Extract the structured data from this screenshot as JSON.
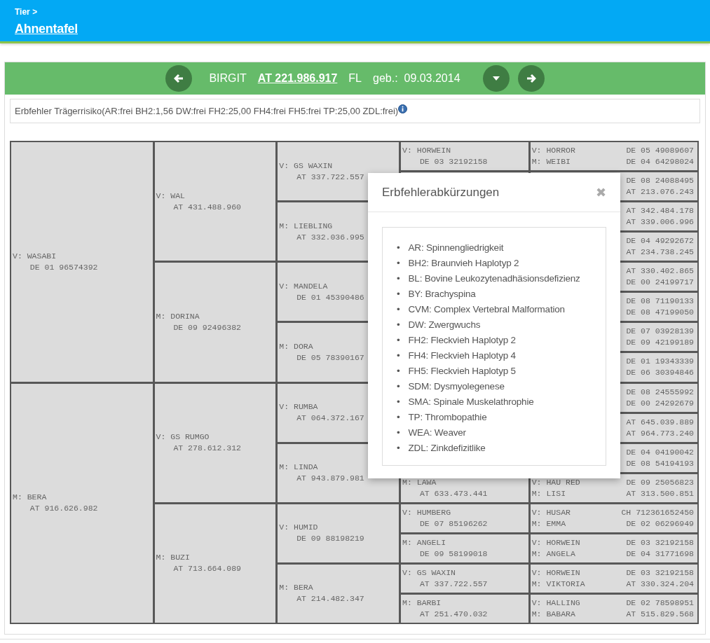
{
  "header": {
    "breadcrumb": "Tier >",
    "title": "Ahnentafel"
  },
  "animal": {
    "name": "BIRGIT",
    "id": "AT 221.986.917",
    "breed": "FL",
    "born_label": "geb.:",
    "born": "09.03.2014"
  },
  "risk": {
    "text": "Erbfehler Trägerrisiko(AR:frei BH2:1,56 DW:frei FH2:25,00 FH4:frei FH5:frei TP:25,00 ZDL:frei)"
  },
  "pedigree": {
    "generations": [
      [
        {
          "sex": "V:",
          "name": "WASABI",
          "id": "DE 01 96574392"
        },
        {
          "sex": "M:",
          "name": "BERA",
          "id": "AT 916.626.982"
        }
      ],
      [
        {
          "sex": "V:",
          "name": "WAL",
          "id": "AT 431.488.960"
        },
        {
          "sex": "M:",
          "name": "DORINA",
          "id": "DE 09 92496382"
        },
        {
          "sex": "V:",
          "name": "GS RUMGO",
          "id": "AT 278.612.312"
        },
        {
          "sex": "M:",
          "name": "BUZI",
          "id": "AT 713.664.089"
        }
      ],
      [
        {
          "sex": "V:",
          "name": "GS WAXIN",
          "id": "AT 337.722.557"
        },
        {
          "sex": "M:",
          "name": "LIEBLING",
          "id": "AT 332.036.995"
        },
        {
          "sex": "V:",
          "name": "MANDELA",
          "id": "DE 01 45390486"
        },
        {
          "sex": "M:",
          "name": "DORA",
          "id": "DE 05 78390167"
        },
        {
          "sex": "V:",
          "name": "RUMBA",
          "id": "AT 064.372.167"
        },
        {
          "sex": "M:",
          "name": "LINDA",
          "id": "AT 943.879.981"
        },
        {
          "sex": "V:",
          "name": "HUMID",
          "id": "DE 09 88198219"
        },
        {
          "sex": "M:",
          "name": "BERA",
          "id": "AT 214.482.347"
        }
      ],
      {
        "top": [
          {
            "sex": "V:",
            "name": "HORWEIN",
            "id": "DE 03 32192158"
          }
        ],
        "bottom": [
          {
            "sex": "M:",
            "name": "LAWA",
            "id": "AT 633.473.441"
          },
          {
            "sex": "V:",
            "name": "HUMBERG",
            "id": "DE 07 85196262"
          },
          {
            "sex": "M:",
            "name": "ANGELI",
            "id": "DE 09 58199018"
          },
          {
            "sex": "V:",
            "name": "GS WAXIN",
            "id": "AT 337.722.557"
          },
          {
            "sex": "M:",
            "name": "BARBI",
            "id": "AT 251.470.032"
          }
        ]
      },
      [
        {
          "sire": {
            "sex": "V:",
            "name": "HORROR",
            "id": "DE 05 49089607"
          },
          "dam": {
            "sex": "M:",
            "name": "WEIBI",
            "id": "DE 04 64298024"
          }
        },
        {
          "sire": {
            "id": "DE 08 24088495"
          },
          "dam": {
            "id": "AT 213.076.243"
          }
        },
        {
          "sire": {
            "id": "AT 342.484.178"
          },
          "dam": {
            "id": "AT 339.006.996"
          }
        },
        {
          "sire": {
            "id": "DE 04 49292672"
          },
          "dam": {
            "id": "AT 234.738.245"
          }
        },
        {
          "sire": {
            "id": "AT 330.402.865"
          },
          "dam": {
            "id": "DE 00 24199717"
          }
        },
        {
          "sire": {
            "id": "DE 08 71190133"
          },
          "dam": {
            "id": "DE 08 47199050"
          }
        },
        {
          "sire": {
            "id": "DE 07 03928139"
          },
          "dam": {
            "id": "DE 09 42199189"
          }
        },
        {
          "sire": {
            "id": "DE 01 19343339"
          },
          "dam": {
            "id": "DE 06 30394846"
          }
        },
        {
          "sire": {
            "id": "DE 08 24555992"
          },
          "dam": {
            "id": "DE 00 24292679"
          }
        },
        {
          "sire": {
            "id": "AT 645.039.889"
          },
          "dam": {
            "id": "AT 964.773.240"
          }
        },
        {
          "sire": {
            "id": "DE 04 04190042"
          },
          "dam": {
            "id": "DE 08 54194193"
          }
        },
        {
          "sire": {
            "sex": "V:",
            "name": "HAU RED",
            "id": "DE 09 25056823"
          },
          "dam": {
            "sex": "M:",
            "name": "LISI",
            "id": "AT 313.500.851"
          }
        },
        {
          "sire": {
            "sex": "V:",
            "name": "HUSAR",
            "id": "CH 712361652450"
          },
          "dam": {
            "sex": "M:",
            "name": "EMMA",
            "id": "DE 02 06296949"
          }
        },
        {
          "sire": {
            "sex": "V:",
            "name": "HORWEIN",
            "id": "DE 03 32192158"
          },
          "dam": {
            "sex": "M:",
            "name": "ANGELA",
            "id": "DE 04 31771698"
          }
        },
        {
          "sire": {
            "sex": "V:",
            "name": "HORWEIN",
            "id": "DE 03 32192158"
          },
          "dam": {
            "sex": "M:",
            "name": "VIKTORIA",
            "id": "AT 330.324.204"
          }
        },
        {
          "sire": {
            "sex": "V:",
            "name": "HALLING",
            "id": "DE 02 78598951"
          },
          "dam": {
            "sex": "M:",
            "name": "BABARA",
            "id": "AT 515.829.568"
          }
        }
      ]
    ]
  },
  "modal": {
    "title": "Erbfehlerabkürzungen",
    "close": "✖",
    "marker": "•",
    "items": [
      "AR: Spinnengliedrigkeit",
      "BH2: Braunvieh Haplotyp 2",
      "BL: Bovine Leukozytenadhäsionsdefizienz",
      "BY: Brachyspina",
      "CVM: Complex Vertebral Malformation",
      "DW: Zwergwuchs",
      "FH2: Fleckvieh Haplotyp 2",
      "FH4: Fleckvieh Haplotyp 4",
      "FH5: Fleckvieh Haplotyp 5",
      "SDM: Dysmyolegenese",
      "SMA: Spinale Muskelathrophie",
      "TP: Thrombopathie",
      "WEA: Weaver",
      "ZDL: Zinkdefizitlike"
    ]
  }
}
